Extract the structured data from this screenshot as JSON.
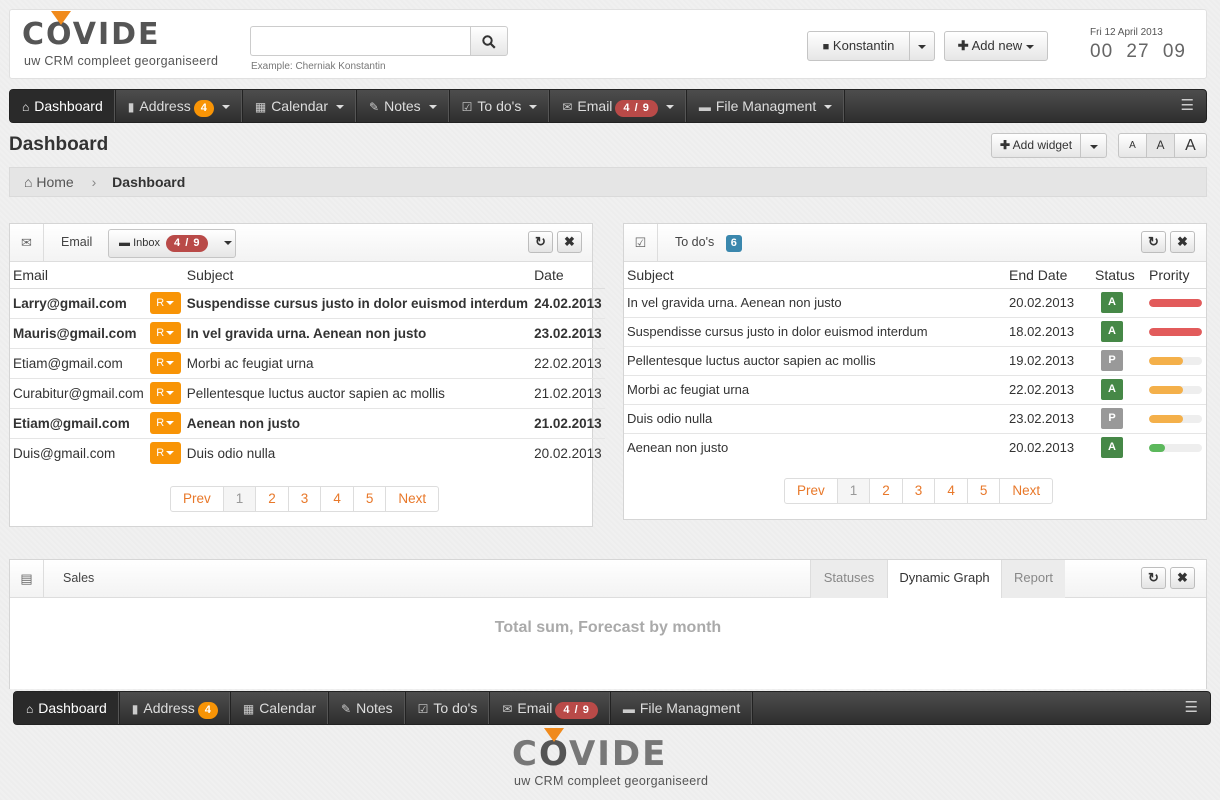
{
  "brand": {
    "name": "COVIDE",
    "tagline": "uw CRM compleet georganiseerd"
  },
  "search": {
    "placeholder": "",
    "hint": "Example: Cherniak Konstantin",
    "icon": "search-icon"
  },
  "user": {
    "name": "Konstantin",
    "icon": "user-icon"
  },
  "add_new": {
    "label": "Add new",
    "icon": "plus-icon"
  },
  "clock": {
    "date": "Fri 12 April 2013",
    "hours": "00",
    "minutes": "27",
    "seconds": "09"
  },
  "nav": [
    {
      "label": "Dashboard",
      "icon": "home-icon",
      "glyph": "⌂",
      "badge": "",
      "caret": false
    },
    {
      "label": "Address",
      "icon": "book-icon",
      "glyph": "▮",
      "badge": "4",
      "badge_color": "orange",
      "caret": true
    },
    {
      "label": "Calendar",
      "icon": "calendar-icon",
      "glyph": "▦",
      "badge": "",
      "caret": true
    },
    {
      "label": "Notes",
      "icon": "pencil-icon",
      "glyph": "✎",
      "badge": "",
      "caret": true
    },
    {
      "label": "To do's",
      "icon": "check-icon",
      "glyph": "☑",
      "badge": "",
      "caret": true
    },
    {
      "label": "Email",
      "icon": "envelope-icon",
      "glyph": "✉",
      "badge": "4 / 9",
      "badge_color": "red",
      "caret": true
    },
    {
      "label": "File Managment",
      "icon": "folder-icon",
      "glyph": "▬",
      "badge": "",
      "caret": true
    }
  ],
  "page": {
    "title": "Dashboard",
    "add_widget": "Add widget",
    "font_sizes": [
      "A",
      "A",
      "A"
    ]
  },
  "breadcrumb": {
    "home": "Home",
    "current": "Dashboard"
  },
  "email_widget": {
    "title": "Email",
    "folder": "Inbox",
    "folder_badge": "4 / 9",
    "columns": [
      "Email",
      "Subject",
      "Date"
    ],
    "rows": [
      {
        "email": "Larry@gmail.com",
        "r": "R",
        "subject": "Suspendisse cursus justo in dolor euismod interdum",
        "date": "24.02.2013",
        "unread": true
      },
      {
        "email": "Mauris@gmail.com",
        "r": "R",
        "subject": "In vel gravida urna. Aenean non justo",
        "date": "23.02.2013",
        "unread": true
      },
      {
        "email": "Etiam@gmail.com",
        "r": "R",
        "subject": "Morbi ac feugiat urna",
        "date": "22.02.2013",
        "unread": false
      },
      {
        "email": "Curabitur@gmail.com",
        "r": "R",
        "subject": "Pellentesque luctus auctor sapien ac mollis",
        "date": "21.02.2013",
        "unread": false
      },
      {
        "email": "Etiam@gmail.com",
        "r": "R",
        "subject": "Aenean non justo",
        "date": "21.02.2013",
        "unread": true
      },
      {
        "email": "Duis@gmail.com",
        "r": "R",
        "subject": "Duis odio nulla",
        "date": "20.02.2013",
        "unread": false
      }
    ],
    "pager": [
      "Prev",
      "1",
      "2",
      "3",
      "4",
      "5",
      "Next"
    ]
  },
  "todo_widget": {
    "title": "To do's",
    "badge": "6",
    "columns": [
      "Subject",
      "End Date",
      "Status",
      "Prority"
    ],
    "rows": [
      {
        "subject": "In vel gravida urna. Aenean non justo",
        "end_date": "20.02.2013",
        "status": "A",
        "priority": 1.0,
        "priority_color": "#e25b5b"
      },
      {
        "subject": "Suspendisse cursus justo in dolor euismod interdum",
        "end_date": "18.02.2013",
        "status": "A",
        "priority": 1.0,
        "priority_color": "#e25b5b"
      },
      {
        "subject": "Pellentesque luctus auctor sapien ac mollis",
        "end_date": "19.02.2013",
        "status": "P",
        "priority": 0.65,
        "priority_color": "#f4b04a"
      },
      {
        "subject": "Morbi ac feugiat urna",
        "end_date": "22.02.2013",
        "status": "A",
        "priority": 0.65,
        "priority_color": "#f4b04a"
      },
      {
        "subject": "Duis odio nulla",
        "end_date": "23.02.2013",
        "status": "P",
        "priority": 0.65,
        "priority_color": "#f4b04a"
      },
      {
        "subject": "Aenean non justo",
        "end_date": "20.02.2013",
        "status": "A",
        "priority": 0.3,
        "priority_color": "#5cb85c"
      }
    ],
    "status_colors": {
      "A": "#468847",
      "P": "#999999"
    },
    "pager": [
      "Prev",
      "1",
      "2",
      "3",
      "4",
      "5",
      "Next"
    ]
  },
  "sales_widget": {
    "title": "Sales",
    "tabs": [
      "Statuses",
      "Dynamic Graph",
      "Report"
    ],
    "active_tab": "Dynamic Graph",
    "chart_title": "Total sum, Forecast by month"
  },
  "footer_nav": [
    {
      "label": "Dashboard",
      "icon": "home-icon",
      "glyph": "⌂",
      "badge": ""
    },
    {
      "label": "Address",
      "icon": "book-icon",
      "glyph": "▮",
      "badge": "4",
      "badge_color": "orange"
    },
    {
      "label": "Calendar",
      "icon": "calendar-icon",
      "glyph": "▦",
      "badge": ""
    },
    {
      "label": "Notes",
      "icon": "pencil-icon",
      "glyph": "✎",
      "badge": ""
    },
    {
      "label": "To do's",
      "icon": "check-icon",
      "glyph": "☑",
      "badge": ""
    },
    {
      "label": "Email",
      "icon": "envelope-icon",
      "glyph": "✉",
      "badge": "4 / 9",
      "badge_color": "red"
    },
    {
      "label": "File Managment",
      "icon": "folder-icon",
      "glyph": "▬",
      "badge": ""
    }
  ],
  "colors": {
    "accent": "#f08a1c",
    "badge_orange": "#f89406",
    "badge_red": "#b94a48",
    "nav_dark": "#333333"
  }
}
